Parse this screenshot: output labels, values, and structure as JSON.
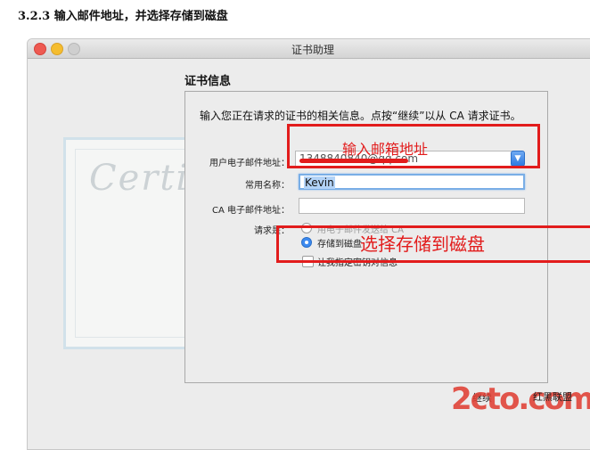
{
  "document": {
    "heading": "3.2.3 输入邮件地址，并选择存储到磁盘"
  },
  "window": {
    "title": "证书助理"
  },
  "panel": {
    "heading": "证书信息",
    "instruction": "输入您正在请求的证书的相关信息。点按“继续”以从 CA 请求证书。"
  },
  "form": {
    "user_email_label": "用户电子邮件地址：",
    "user_email_value": "1348840840@qq.com",
    "common_name_label": "常用名称：",
    "common_name_value": "Kevin",
    "ca_email_label": "CA 电子邮件地址：",
    "ca_email_value": "",
    "request_label": "请求是：",
    "options": [
      {
        "label": "用电子邮件发送给 CA",
        "selected": false
      },
      {
        "label": "存储到磁盘",
        "selected": true
      }
    ],
    "checkbox_label": "让我指定密钥对信息",
    "checkbox_checked": false
  },
  "annotations": {
    "email_note": "输入邮箱地址",
    "disk_note": "选择存储到磁盘"
  },
  "footer": {
    "continue_label": "继续"
  },
  "watermark": {
    "logo": "2cto.com",
    "sub": "红黑联盟"
  },
  "colors": {
    "annotation": "#e21c1c",
    "accent": "#3d8af0"
  }
}
